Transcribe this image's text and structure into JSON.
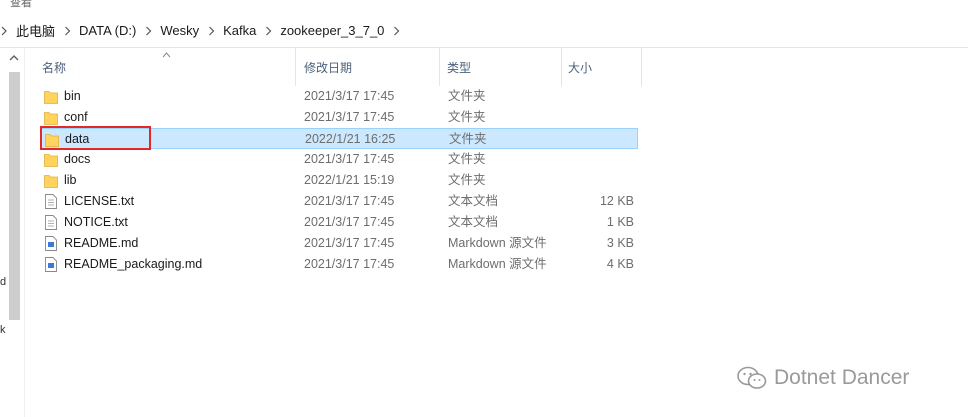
{
  "title_fragment": "查看",
  "address": {
    "crumbs": [
      "此电脑",
      "DATA (D:)",
      "Wesky",
      "Kafka",
      "zookeeper_3_7_0"
    ]
  },
  "nav_fragments": [
    "d",
    "k"
  ],
  "columns": {
    "name": "名称",
    "date": "修改日期",
    "type": "类型",
    "size": "大小"
  },
  "files": [
    {
      "name": "bin",
      "date": "2021/3/17 17:45",
      "type": "文件夹",
      "size": "",
      "icon": "folder-icon"
    },
    {
      "name": "conf",
      "date": "2021/3/17 17:45",
      "type": "文件夹",
      "size": "",
      "icon": "folder-icon"
    },
    {
      "name": "data",
      "date": "2022/1/21 16:25",
      "type": "文件夹",
      "size": "",
      "icon": "folder-icon"
    },
    {
      "name": "docs",
      "date": "2021/3/17 17:45",
      "type": "文件夹",
      "size": "",
      "icon": "folder-icon"
    },
    {
      "name": "lib",
      "date": "2022/1/21 15:19",
      "type": "文件夹",
      "size": "",
      "icon": "folder-icon"
    },
    {
      "name": "LICENSE.txt",
      "date": "2021/3/17 17:45",
      "type": "文本文档",
      "size": "12 KB",
      "icon": "text-file-icon"
    },
    {
      "name": "NOTICE.txt",
      "date": "2021/3/17 17:45",
      "type": "文本文档",
      "size": "1 KB",
      "icon": "text-file-icon"
    },
    {
      "name": "README.md",
      "date": "2021/3/17 17:45",
      "type": "Markdown 源文件",
      "size": "3 KB",
      "icon": "markdown-file-icon"
    },
    {
      "name": "README_packaging.md",
      "date": "2021/3/17 17:45",
      "type": "Markdown 源文件",
      "size": "4 KB",
      "icon": "markdown-file-icon"
    }
  ],
  "selected_file": "data",
  "watermark": {
    "text": "Dotnet Dancer"
  },
  "colors": {
    "selection": "#cce8ff",
    "highlight_box": "#e4272b",
    "folder": "#ffd35c"
  }
}
